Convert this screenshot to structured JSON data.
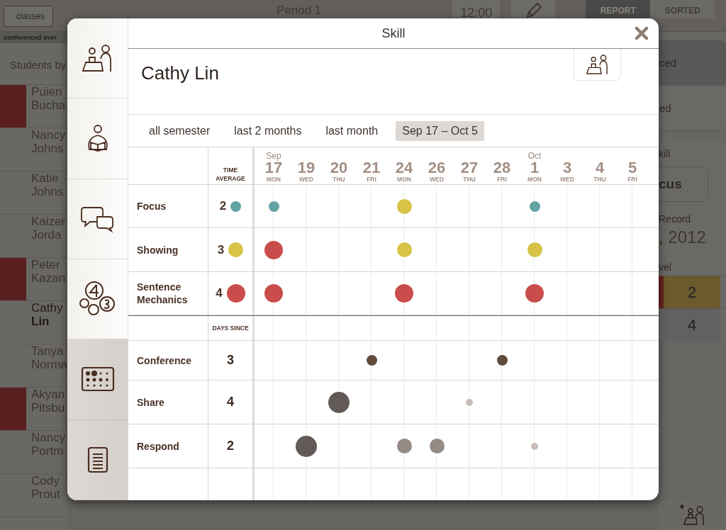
{
  "background": {
    "back_button": "classes",
    "period": "Period 1",
    "time": "12:00",
    "tabs": [
      {
        "label": "REPORT",
        "selected": true
      },
      {
        "label": "SORTED",
        "selected": false
      }
    ],
    "list_banner": "conferenced over",
    "list_header": "Students by",
    "students": [
      {
        "first": "Puien",
        "last": "Bucha",
        "flagged": true,
        "selected": false
      },
      {
        "first": "Nancy",
        "last": "Johns",
        "flagged": false,
        "selected": false
      },
      {
        "first": "Katie",
        "last": "Johns",
        "flagged": false,
        "selected": false
      },
      {
        "first": "Kaizer",
        "last": "Jorda",
        "flagged": false,
        "selected": false
      },
      {
        "first": "Peter",
        "last": "Kazan",
        "flagged": true,
        "selected": false
      },
      {
        "first": "Cathy",
        "last": "Lin",
        "flagged": false,
        "selected": true
      },
      {
        "first": "Tanya",
        "last": "Norma",
        "flagged": false,
        "selected": false
      },
      {
        "first": "Akyan",
        "last": "Pitsbu",
        "flagged": true,
        "selected": false
      },
      {
        "first": "Nancy",
        "last": "Portm",
        "flagged": false,
        "selected": false
      },
      {
        "first": "Cody",
        "last": "Prout",
        "flagged": false,
        "selected": false
      }
    ],
    "side": {
      "rows": [
        {
          "label": "ced",
          "selected": true
        },
        {
          "label": "ed",
          "selected": false
        }
      ],
      "skill_label": "kill",
      "skill_value": "cus",
      "record_label": "Record",
      "record_value": ", 2012",
      "level_label": "vel",
      "levels": [
        {
          "value": "2",
          "color": "#6b5a2c",
          "flagged": true
        },
        {
          "value": "4",
          "color": "#626060",
          "flagged": false
        }
      ]
    }
  },
  "modal": {
    "title": "Skill",
    "student": "Cathy Lin",
    "rail": [
      {
        "kind": "conference",
        "dimmed": false
      },
      {
        "kind": "reading",
        "dimmed": false
      },
      {
        "kind": "conversation",
        "dimmed": false
      },
      {
        "kind": "levels",
        "dimmed": false
      },
      {
        "kind": "dots",
        "dimmed": true
      },
      {
        "kind": "notes",
        "dimmed": true
      }
    ],
    "ranges": [
      {
        "label": "all semester",
        "selected": false
      },
      {
        "label": "last 2 months",
        "selected": false
      },
      {
        "label": "last month",
        "selected": false
      },
      {
        "label": "Sep 17 – Oct 5",
        "selected": true
      }
    ],
    "avg_header": "TIME AVERAGE",
    "dates": [
      {
        "month": "Sep",
        "day": "17",
        "weekday": "MON"
      },
      {
        "day": "19",
        "weekday": "WED"
      },
      {
        "day": "20",
        "weekday": "THU"
      },
      {
        "day": "21",
        "weekday": "FRI"
      },
      {
        "day": "24",
        "weekday": "MON"
      },
      {
        "day": "26",
        "weekday": "WED"
      },
      {
        "day": "27",
        "weekday": "THU"
      },
      {
        "day": "28",
        "weekday": "FRI"
      },
      {
        "month": "Oct",
        "day": "1",
        "weekday": "MON"
      },
      {
        "day": "3",
        "weekday": "WED"
      },
      {
        "day": "4",
        "weekday": "THU"
      },
      {
        "day": "5",
        "weekday": "FRI"
      }
    ],
    "skills": [
      {
        "name": "Focus",
        "average": "2",
        "avg_dot": {
          "kind": "small",
          "color": "#62a3a4"
        },
        "dots": [
          {
            "kind": "small",
            "color": "#62a3a4"
          },
          {
            "kind": "empty"
          },
          {
            "kind": "empty"
          },
          {
            "kind": "empty"
          },
          {
            "kind": "medium",
            "color": "#d8c348"
          },
          {
            "kind": "empty"
          },
          {
            "kind": "empty"
          },
          {
            "kind": "empty"
          },
          {
            "kind": "small",
            "color": "#62a3a4"
          },
          {
            "kind": "empty"
          },
          {
            "kind": "empty"
          },
          {
            "kind": "empty"
          }
        ]
      },
      {
        "name": "Showing",
        "average": "3",
        "avg_dot": {
          "kind": "medium",
          "color": "#d8c348"
        },
        "dots": [
          {
            "kind": "large",
            "color": "#c94d4b"
          },
          {
            "kind": "empty"
          },
          {
            "kind": "empty"
          },
          {
            "kind": "empty"
          },
          {
            "kind": "medium",
            "color": "#d8c348"
          },
          {
            "kind": "empty"
          },
          {
            "kind": "empty"
          },
          {
            "kind": "empty"
          },
          {
            "kind": "medium",
            "color": "#d8c348"
          },
          {
            "kind": "empty"
          },
          {
            "kind": "empty"
          },
          {
            "kind": "empty"
          }
        ]
      },
      {
        "name": "Sentence Mechanics",
        "average": "4",
        "avg_dot": {
          "kind": "large",
          "color": "#c94d4b"
        },
        "dots": [
          {
            "kind": "large",
            "color": "#c94d4b"
          },
          {
            "kind": "empty"
          },
          {
            "kind": "empty"
          },
          {
            "kind": "empty"
          },
          {
            "kind": "large",
            "color": "#c94d4b"
          },
          {
            "kind": "empty"
          },
          {
            "kind": "empty"
          },
          {
            "kind": "empty"
          },
          {
            "kind": "large",
            "color": "#c94d4b"
          },
          {
            "kind": "empty"
          },
          {
            "kind": "empty"
          },
          {
            "kind": "empty"
          }
        ]
      }
    ],
    "since_header": "DAYS SINCE",
    "activities": [
      {
        "name": "Conference",
        "days": "3",
        "dots": [
          {
            "kind": "empty"
          },
          {
            "kind": "empty"
          },
          {
            "kind": "empty"
          },
          {
            "kind": "small",
            "color": "#5f4a3c"
          },
          {
            "kind": "empty"
          },
          {
            "kind": "empty"
          },
          {
            "kind": "empty"
          },
          {
            "kind": "small",
            "color": "#5f4a3c"
          },
          {
            "kind": "empty"
          },
          {
            "kind": "empty"
          },
          {
            "kind": "empty"
          },
          {
            "kind": "empty"
          }
        ]
      },
      {
        "name": "Share",
        "days": "4",
        "dots": [
          {
            "kind": "empty"
          },
          {
            "kind": "empty"
          },
          {
            "kind": "xlarge",
            "color": "#625a57"
          },
          {
            "kind": "empty"
          },
          {
            "kind": "empty"
          },
          {
            "kind": "empty"
          },
          {
            "kind": "tiny",
            "color": "#c8bcb7"
          },
          {
            "kind": "empty"
          },
          {
            "kind": "empty"
          },
          {
            "kind": "empty"
          },
          {
            "kind": "empty"
          },
          {
            "kind": "empty"
          }
        ]
      },
      {
        "name": "Respond",
        "days": "2",
        "dots": [
          {
            "kind": "empty"
          },
          {
            "kind": "xlarge",
            "color": "#625a57"
          },
          {
            "kind": "empty"
          },
          {
            "kind": "empty"
          },
          {
            "kind": "medium",
            "color": "#958a85"
          },
          {
            "kind": "medium",
            "color": "#958a85"
          },
          {
            "kind": "empty"
          },
          {
            "kind": "empty"
          },
          {
            "kind": "tiny",
            "color": "#c8bcb7"
          },
          {
            "kind": "empty"
          },
          {
            "kind": "empty"
          },
          {
            "kind": "empty"
          }
        ]
      }
    ]
  }
}
